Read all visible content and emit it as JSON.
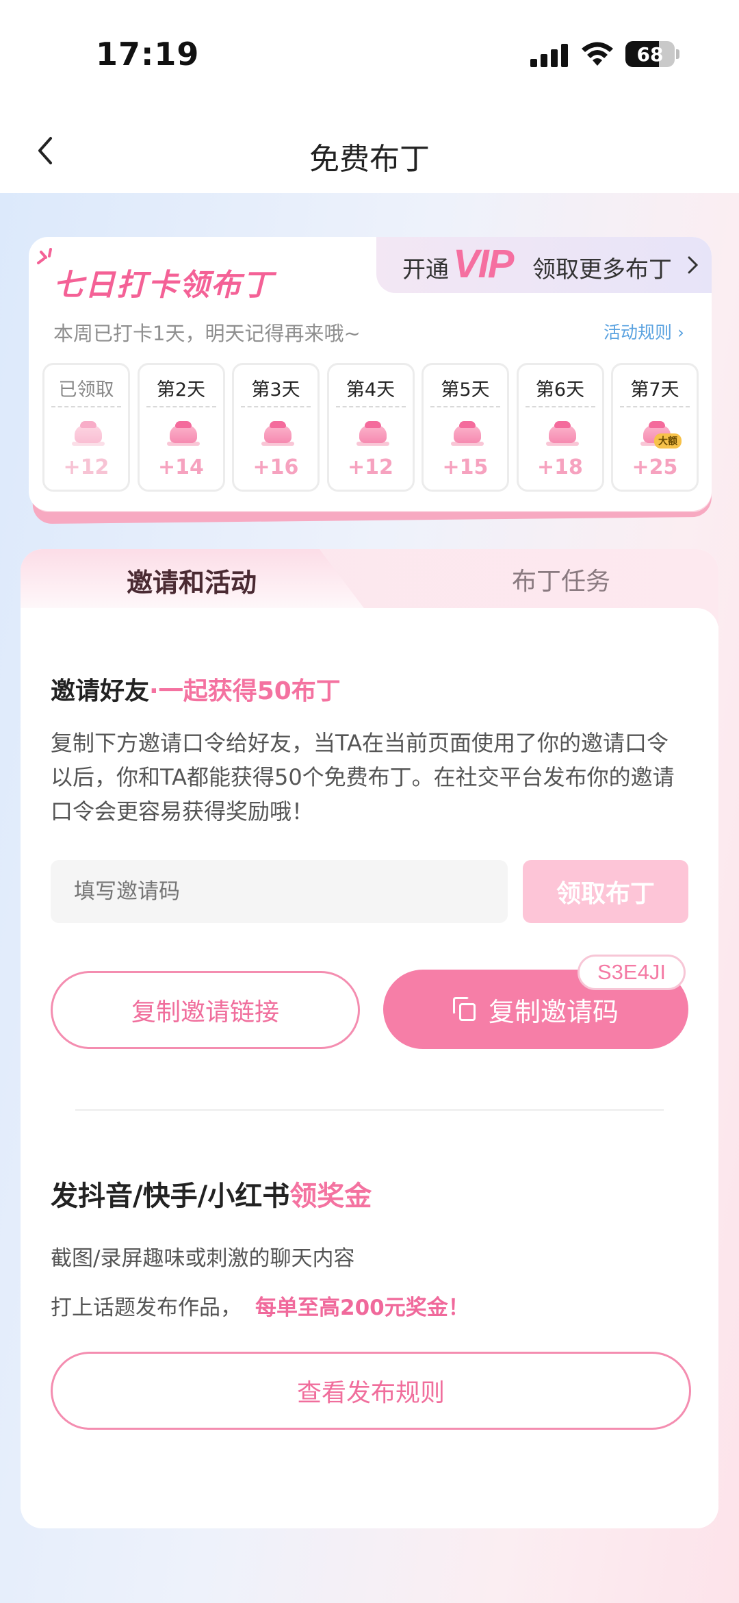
{
  "status_bar": {
    "time": "17:19",
    "battery": "68",
    "battery_level": 0.68
  },
  "nav": {
    "title": "免费布丁"
  },
  "checkin": {
    "title": "七日打卡领布丁",
    "vip_open": "开通",
    "vip_logo": "VIP",
    "vip_more": "领取更多布丁",
    "subtitle": "本周已打卡1天，明天记得再来哦~",
    "rules_link": "活动规则 ›",
    "days": [
      {
        "label": "已领取",
        "points": "+12",
        "claimed": true
      },
      {
        "label": "第2天",
        "points": "+14",
        "claimed": false
      },
      {
        "label": "第3天",
        "points": "+16",
        "claimed": false
      },
      {
        "label": "第4天",
        "points": "+12",
        "claimed": false
      },
      {
        "label": "第5天",
        "points": "+15",
        "claimed": false
      },
      {
        "label": "第6天",
        "points": "+18",
        "claimed": false
      },
      {
        "label": "第7天",
        "points": "+25",
        "claimed": false,
        "badge": "大额"
      }
    ]
  },
  "tabs": {
    "active": "邀请和活动",
    "inactive": "布丁任务"
  },
  "invite": {
    "title": "邀请好友",
    "title_accent": "·一起获得50布丁",
    "description": "复制下方邀请口令给好友，当TA在当前页面使用了你的邀请口令以后，你和TA都能获得50个免费布丁。在社交平台发布你的邀请口令会更容易获得奖励哦！",
    "input_placeholder": "填写邀请码",
    "claim_button": "领取布丁",
    "copy_link_button": "复制邀请链接",
    "copy_code_button": "复制邀请码",
    "code": "S3E4JI"
  },
  "post": {
    "title": "发抖音/快手/小红书",
    "title_accent": "领奖金",
    "line1": "截图/录屏趣味或刺激的聊天内容",
    "line2": "打上话题发布作品，",
    "line2_highlight": "每单至高200元奖金！",
    "rules_button": "查看发布规则"
  },
  "colors": {
    "accent": "#f472a0",
    "button_pink": "#f67ea7",
    "link_blue": "#5aa2e0"
  }
}
